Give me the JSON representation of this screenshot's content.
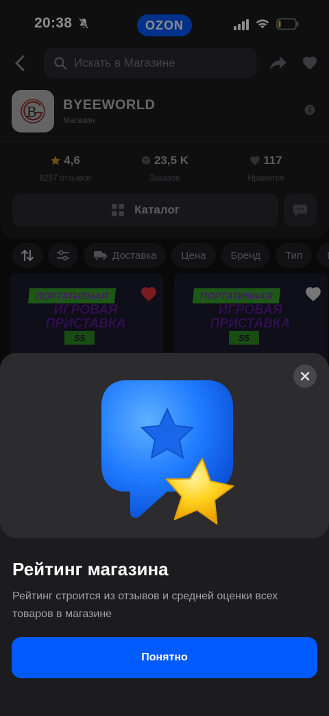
{
  "status_bar": {
    "time": "20:38",
    "brand": "OZON"
  },
  "header": {
    "search_placeholder": "Искать в Магазине"
  },
  "store": {
    "name": "BYEEWORLD",
    "type": "Магазин",
    "logo_letter": "B"
  },
  "stats": [
    {
      "value": "4,6",
      "label": "8257 отзывов",
      "icon": "star-icon"
    },
    {
      "value": "23,5 K",
      "label": "Заказов",
      "icon": "cube-icon"
    },
    {
      "value": "117",
      "label": "Нравится",
      "icon": "heart-icon"
    }
  ],
  "catalog_label": "Каталог",
  "filters": [
    "Доставка",
    "Цена",
    "Бренд",
    "Тип",
    "Цв"
  ],
  "products": [
    {
      "line1": "ПОРТАТИВНАЯ",
      "line2": "ИГРОВАЯ ПРИСТАВКА",
      "line3": "S5",
      "favorite": true
    },
    {
      "line1": "ПОРТАТИВНАЯ",
      "line2": "ИГРОВАЯ ПРИСТАВКА",
      "line3": "S5",
      "favorite": false
    }
  ],
  "sheet": {
    "title": "Рейтинг магазина",
    "description": "Рейтинг строится из отзывов и средней оценки всех товаров в магазине",
    "button_label": "Понятно"
  },
  "colors": {
    "accent": "#005bff",
    "favorite": "#e0303a",
    "star": "#f5c518"
  }
}
